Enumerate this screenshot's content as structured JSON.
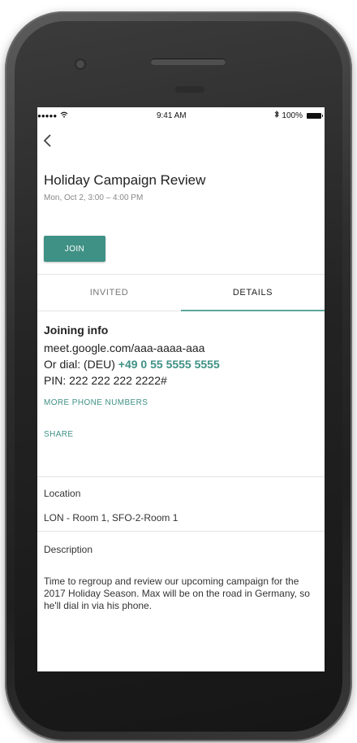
{
  "status": {
    "signal": "●●●●●",
    "time": "9:41 AM",
    "battery": "100%"
  },
  "event": {
    "title": "Holiday Campaign Review",
    "datetime": "Mon, Oct 2, 3:00 – 4:00 PM",
    "join_label": "JOIN"
  },
  "tabs": [
    {
      "label": "INVITED"
    },
    {
      "label": "DETAILS"
    }
  ],
  "details": {
    "joining_heading": "Joining info",
    "meet_url": "meet.google.com/aaa-aaaa-aaa",
    "dial_prefix": "Or dial: (DEU) ",
    "dial_number": "+49 0 55 5555 5555",
    "pin": "PIN: 222 222 222 2222#",
    "more_numbers": "MORE PHONE NUMBERS",
    "share": "SHARE",
    "location_label": "Location",
    "location_value": "LON - Room 1, SFO-2-Room 1",
    "description_label": "Description",
    "description_text": "Time to regroup and review our upcoming campaign for the 2017 Holiday Season. Max will be on the road in Germany, so he'll dial in via his phone."
  },
  "colors": {
    "accent": "#3f9185",
    "tab_indicator": "#5da79c"
  },
  "icons": {
    "back": "chevron-left-icon",
    "wifi": "wifi-icon",
    "bluetooth": "bluetooth-icon",
    "battery": "battery-icon"
  }
}
